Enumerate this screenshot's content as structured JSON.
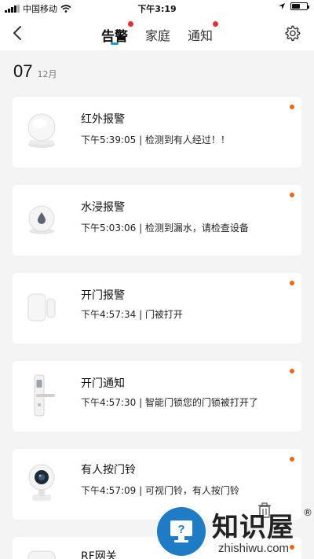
{
  "status_bar": {
    "carrier": "中国移动",
    "time": "下午3:19",
    "battery_level": 0.55
  },
  "nav": {
    "tabs": [
      {
        "label": "告警",
        "active": true,
        "unread_dot": true
      },
      {
        "label": "家庭",
        "active": false,
        "unread_dot": false
      },
      {
        "label": "通知",
        "active": false,
        "unread_dot": true
      }
    ],
    "back_icon": "chevron-left-icon",
    "settings_icon": "gear-icon"
  },
  "date_header": {
    "day": "07",
    "month": "12月"
  },
  "events": [
    {
      "title": "红外报警",
      "description": "下午5:39:05 | 检测到有人经过！！",
      "device_icon": "motion-sensor-icon",
      "unread": true
    },
    {
      "title": "水浸报警",
      "description": "下午5:03:06 | 检测到漏水，请检查设备",
      "device_icon": "water-sensor-icon",
      "unread": true
    },
    {
      "title": "开门报警",
      "description": "下午4:57:34 | 门被打开",
      "device_icon": "door-sensor-icon",
      "unread": true
    },
    {
      "title": "开门通知",
      "description": "下午4:57:30 | 智能门锁您的门锁被打开了",
      "device_icon": "smart-lock-icon",
      "unread": true
    },
    {
      "title": "有人按门铃",
      "description": "下午4:57:09 | 可视门铃，有人按门铃",
      "device_icon": "doorbell-camera-icon",
      "unread": true
    },
    {
      "title": "RF网关",
      "description": "",
      "device_icon": "rf-gateway-icon",
      "unread": true
    }
  ],
  "watermark": {
    "text": "知识屋",
    "sub": "zhishiwu.com",
    "reg": "®"
  },
  "colors": {
    "accent": "#1f9bd8",
    "tab_dot": "#e62e2e",
    "unread_dot": "#f26522",
    "background": "#f4f4f4"
  }
}
